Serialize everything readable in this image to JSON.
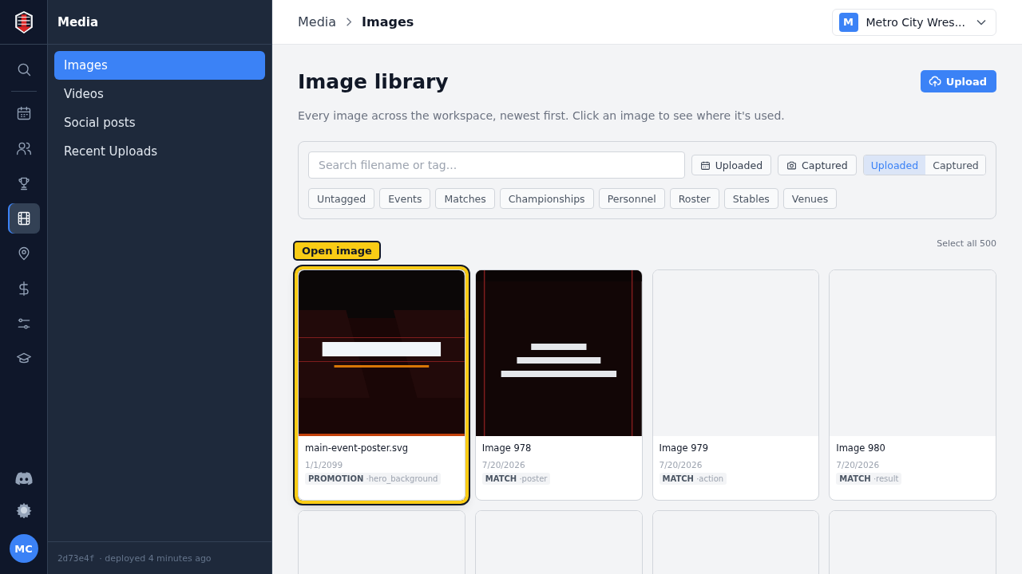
{
  "rail": {
    "items": [
      {
        "selected": false
      },
      {
        "selected": false
      },
      {
        "selected": false
      },
      {
        "selected": false
      },
      {
        "selected": true
      },
      {
        "selected": false
      },
      {
        "selected": false
      },
      {
        "selected": false
      },
      {
        "selected": false
      }
    ],
    "avatar": "MC"
  },
  "sidebar": {
    "title": "Media",
    "items": [
      {
        "label": "Images",
        "selected": true
      },
      {
        "label": "Videos",
        "selected": false
      },
      {
        "label": "Social posts",
        "selected": false
      },
      {
        "label": "Recent Uploads",
        "selected": false
      }
    ],
    "footer_hash": "2d73e4f",
    "footer_text": "· deployed 4 minutes ago"
  },
  "breadcrumb": {
    "parent": "Media",
    "current": "Images"
  },
  "org_switcher": {
    "initial": "M",
    "name": "Metro City Wres..."
  },
  "page": {
    "title": "Image library",
    "upload_button": "Upload",
    "description": "Every image across the workspace, newest first. Click an image to see where it's used."
  },
  "filters": {
    "search": {
      "placeholder": "Search filename or tag..."
    },
    "date_buttons": [
      "Uploaded",
      "Captured"
    ],
    "sort_toggle": [
      {
        "label": "Uploaded",
        "selected": true
      },
      {
        "label": "Captured",
        "selected": false
      }
    ],
    "tags": [
      "Untagged",
      "Events",
      "Matches",
      "Championships",
      "Personnel",
      "Roster",
      "Stables",
      "Venues"
    ]
  },
  "select_all": "Select all 500",
  "cards": [
    {
      "kind": "picture",
      "selected": true,
      "tooltip": "Open image",
      "name": "main-event-poster.svg",
      "date": "1/1/2099",
      "category": "PROMOTION",
      "tag": "·hero_background"
    },
    {
      "kind": "picture",
      "selected": false,
      "name": "Image 978",
      "date": "7/20/2026",
      "category": "MATCH",
      "tag": "·poster"
    },
    {
      "kind": "blank",
      "selected": false,
      "name": "Image 979",
      "date": "7/20/2026",
      "category": "MATCH",
      "tag": "·action"
    },
    {
      "kind": "blank",
      "selected": false,
      "name": "Image 980",
      "date": "7/20/2026",
      "category": "MATCH",
      "tag": "·result"
    },
    {
      "kind": "blank",
      "selected": false
    },
    {
      "kind": "blank",
      "selected": false
    },
    {
      "kind": "blank",
      "selected": false
    },
    {
      "kind": "blank",
      "selected": false
    }
  ]
}
